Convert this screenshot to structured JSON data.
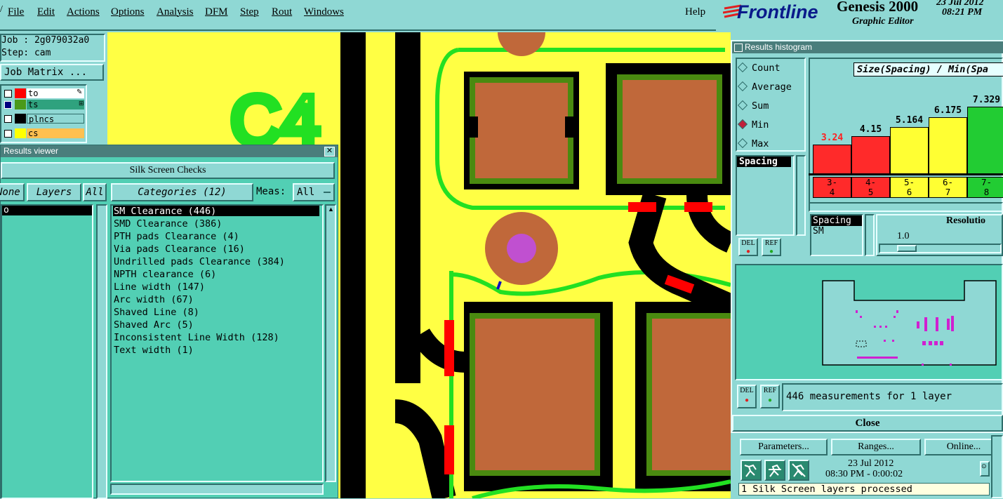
{
  "menubar": {
    "items": [
      "File",
      "Edit",
      "Actions",
      "Options",
      "Analysis",
      "DFM",
      "Step",
      "Rout",
      "Windows"
    ],
    "help": "Help"
  },
  "brand": {
    "logo": "Frontline",
    "product": "Genesis 2000",
    "subtitle": "Graphic Editor",
    "date": "23 Jul 2012",
    "time": "08:21 PM"
  },
  "job": {
    "job_line": "Job : 2g079032a0",
    "step_line": "Step: cam",
    "matrix_button": "Job Matrix ...",
    "layers": [
      {
        "name": "to",
        "color": "#ff0000",
        "bg": "#ffffff"
      },
      {
        "name": "ts",
        "color": "#4a9a1a",
        "bg": "#2fa27e"
      },
      {
        "name": "plncs",
        "color": "#000000",
        "bg": "#8fd8d4"
      },
      {
        "name": "cs",
        "color": "#ffff00",
        "bg": "#ffc050"
      }
    ]
  },
  "canvas": {
    "designator": "C4"
  },
  "results_viewer": {
    "title": "Results viewer",
    "check_name": "Silk Screen Checks",
    "none_label": "None",
    "layers_label": "Layers",
    "all_label": "All",
    "categories_label": "Categories (12)",
    "meas_label": "Meas:",
    "meas_value": "All",
    "layer_list": [
      "o"
    ],
    "categories": [
      "SM Clearance (446)",
      "SMD Clearance (386)",
      "PTH pads Clearance (4)",
      "Via pads Clearance (16)",
      "Undrilled pads Clearance (384)",
      "NPTH clearance (6)",
      "Line width (147)",
      "Arc width (67)",
      "Shaved Line (8)",
      "Shaved Arc (5)",
      "Inconsistent Line Width (128)",
      "Text width (1)"
    ]
  },
  "histogram": {
    "title": "Results histogram",
    "modes": [
      "Count",
      "Average",
      "Sum",
      "Min",
      "Max"
    ],
    "selected_mode": "Min",
    "measure_list": [
      "Spacing"
    ],
    "chart_title": "Size(Spacing) / Min(Spa",
    "del_label": "DEL",
    "ref_label": "REF",
    "spacing_label": "Spacing",
    "sm_label": "SM",
    "resolution_label": "Resolutio",
    "resolution_value": "1.0",
    "status": "446 measurements for 1 layer",
    "close_label": "Close"
  },
  "chart_data": {
    "type": "bar",
    "categories": [
      "3-4",
      "4-5",
      "5-6",
      "6-7",
      "7-8"
    ],
    "values": [
      3.24,
      4.15,
      5.164,
      6.175,
      7.329
    ],
    "colors": [
      "#ff2a2a",
      "#ff2a2a",
      "#ffff33",
      "#ffff33",
      "#22cc33"
    ],
    "value_label_colors": [
      "#ff2020",
      "#000000",
      "#000000",
      "#000000",
      "#000000"
    ],
    "range_labels": [
      [
        "3-",
        "4"
      ],
      [
        "4-",
        "5"
      ],
      [
        "5-",
        "6"
      ],
      [
        "6-",
        "7"
      ],
      [
        "7-",
        "8"
      ]
    ]
  },
  "bottom": {
    "parameters": "Parameters...",
    "ranges": "Ranges...",
    "online": "Online...",
    "date": "23 Jul 2012",
    "timestamp": "08:30 PM - 0:00:02",
    "message": "1 Silk Screen layers processed"
  }
}
